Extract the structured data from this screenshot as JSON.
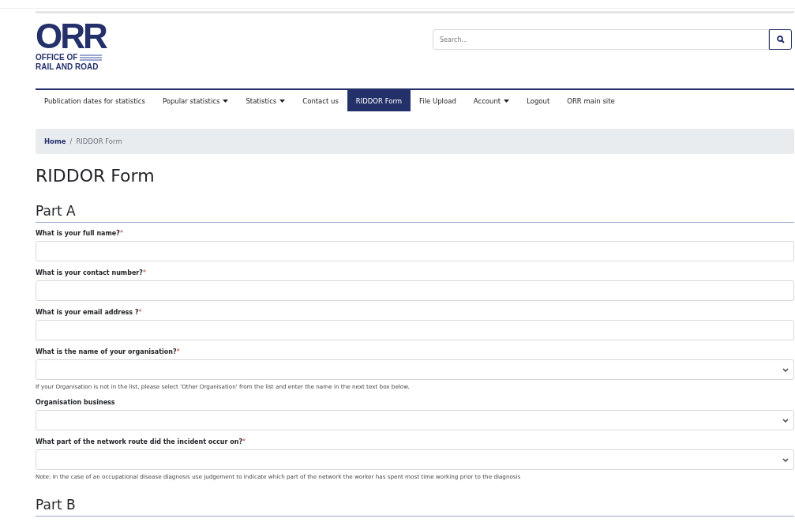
{
  "logo": {
    "mark": "ORR",
    "lines": [
      "OFFICE OF",
      "RAIL AND ROAD"
    ]
  },
  "search": {
    "placeholder": "Search..."
  },
  "nav": [
    {
      "label": "Publication dates for statistics",
      "dropdown": false,
      "selected": false
    },
    {
      "label": "Popular statistics",
      "dropdown": true,
      "selected": false
    },
    {
      "label": "Statistics",
      "dropdown": true,
      "selected": false
    },
    {
      "label": "Contact us",
      "dropdown": false,
      "selected": false
    },
    {
      "label": "RIDDOR Form",
      "dropdown": false,
      "selected": true
    },
    {
      "label": "File Upload",
      "dropdown": false,
      "selected": false
    },
    {
      "label": "Account",
      "dropdown": true,
      "selected": false
    },
    {
      "label": "Logout",
      "dropdown": false,
      "selected": false
    },
    {
      "label": "ORR main site",
      "dropdown": false,
      "selected": false
    }
  ],
  "breadcrumb_separator": "/",
  "breadcrumb": [
    {
      "label": "Home",
      "current": false
    },
    {
      "label": "RIDDOR Form",
      "current": true
    }
  ],
  "title": "RIDDOR Form",
  "sections": [
    {
      "heading": "Part A",
      "fields": [
        {
          "label": "What is your full name?",
          "required": true,
          "kind": "text"
        },
        {
          "label": "What is your contact number?",
          "required": true,
          "kind": "text"
        },
        {
          "label": "What is your email address ?",
          "required": true,
          "kind": "text"
        },
        {
          "label": "What is the name of your organisation?",
          "required": true,
          "kind": "select",
          "help": "If your Organisation is not in the list, please select 'Other Organisation' from the list and enter the name in the next text box below."
        },
        {
          "label": "Organisation business",
          "required": false,
          "kind": "select"
        },
        {
          "label": "What part of the network route did the incident occur on?",
          "required": true,
          "kind": "select",
          "help": "Note: In the case of an occupational disease diagnosis use judgement to indicate which part of the network the worker has spent most time working prior to the diagnosis"
        }
      ]
    },
    {
      "heading": "Part B"
    }
  ],
  "required_mark": "*"
}
